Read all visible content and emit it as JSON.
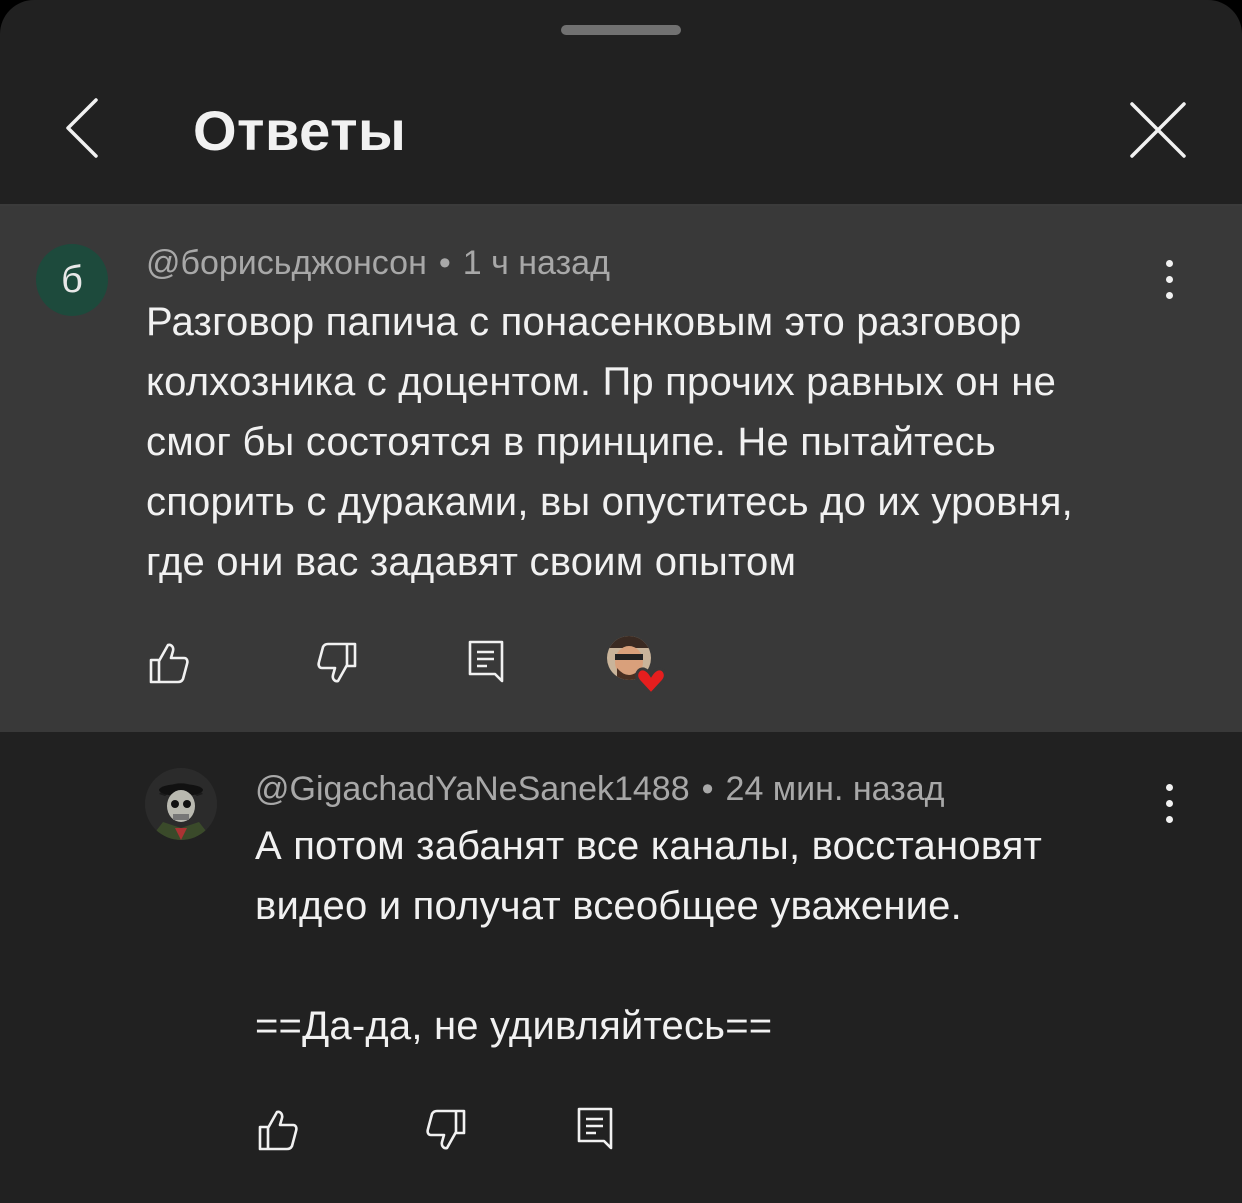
{
  "header": {
    "title": "Ответы"
  },
  "parent_comment": {
    "avatar_letter": "б",
    "author": "@борисьджонсон",
    "separator": "•",
    "time": "1 ч назад",
    "text": "Разговор папича с понасенковым это разговор\nколхозника с доцентом. Пр прочих равных он не\nсмог бы состоятся в принципе. Не пытайтесь\nспорить с дураками, вы опуститесь до их уровня,\nгде они вас задавят своим опытом",
    "creator_heart": true
  },
  "reply": {
    "author": "@GigachadYaNeSanek1488",
    "separator": "•",
    "time": "24 мин. назад",
    "text": "А потом забанят все каналы, восстановят\nвидео и получат всеобщее уважение.\n\n==Да-да, не удивляйтесь=="
  },
  "colors": {
    "sheet_bg": "#212121",
    "highlight_bg": "#393939",
    "text_primary": "#f1f1f1",
    "text_secondary": "#a8a8a8",
    "avatar_bg": "#1d4a3c",
    "heart": "#e51e1e"
  },
  "icons": {
    "back": "chevron-left-icon",
    "close": "close-icon",
    "like": "thumb-up-icon",
    "dislike": "thumb-down-icon",
    "reply": "comment-icon",
    "more": "more-vertical-icon",
    "creator_heart": "creator-heart-icon"
  }
}
